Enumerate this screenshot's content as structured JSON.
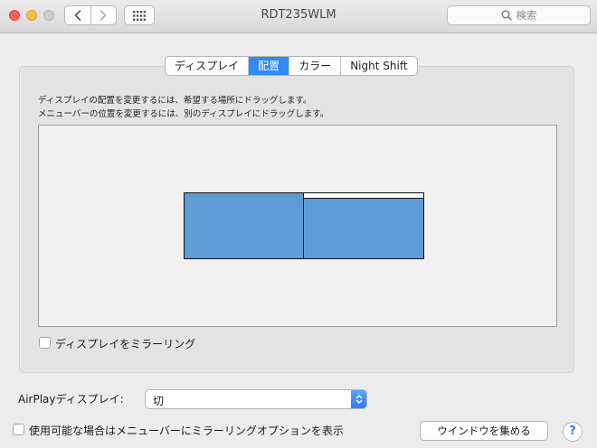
{
  "window": {
    "title": "RDT235WLM"
  },
  "toolbar": {
    "back_icon": "chevron-left-icon",
    "forward_icon": "chevron-right-icon",
    "show_all_icon": "grid-icon",
    "search_placeholder": "検索"
  },
  "tabs": [
    {
      "label": "ディスプレイ",
      "active": false
    },
    {
      "label": "配置",
      "active": true
    },
    {
      "label": "カラー",
      "active": false
    },
    {
      "label": "Night Shift",
      "active": false
    }
  ],
  "arrangement": {
    "instruction_line1": "ディスプレイの配置を変更するには、希望する場所にドラッグします。",
    "instruction_line2": "メニューバーの位置を変更するには、別のディスプレイにドラッグします。",
    "display_color": "#5f9bd4",
    "mirror_label": "ディスプレイをミラーリング",
    "mirror_checked": false
  },
  "airplay": {
    "label": "AirPlayディスプレイ:",
    "value": "切"
  },
  "mirror_menu": {
    "label": "使用可能な場合はメニューバーにミラーリングオプションを表示",
    "checked": false
  },
  "buttons": {
    "gather_windows": "ウインドウを集める",
    "help": "?"
  },
  "colors": {
    "accent": "#2f89f7",
    "close": "#fc605c",
    "minimize": "#fdbc40",
    "zoom_disabled": "#cdcdcd"
  }
}
